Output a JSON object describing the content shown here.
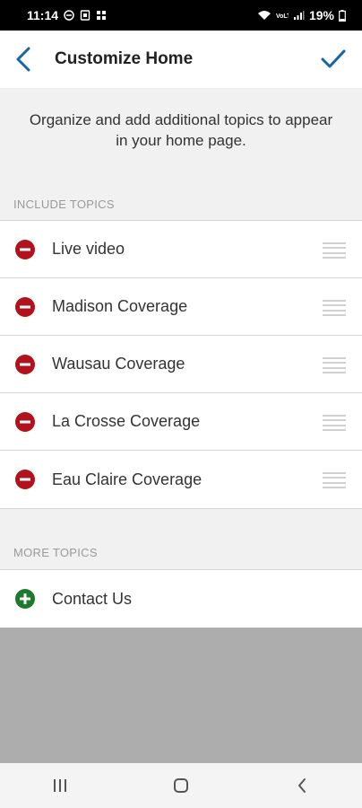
{
  "status_bar": {
    "time": "11:14",
    "battery": "19%",
    "icons": [
      "do-not-disturb-icon",
      "screenshot-icon",
      "grid-app-icon",
      "wifi-icon",
      "volte-icon",
      "signal-icon",
      "battery-icon"
    ]
  },
  "header": {
    "title": "Customize Home",
    "back_icon": "chevron-left-icon",
    "confirm_icon": "checkmark-icon",
    "accent_color": "#1565a8"
  },
  "intro": {
    "text": "Organize and add additional topics to appear in your home page."
  },
  "include_topics": {
    "label": "INCLUDE TOPICS",
    "items": [
      {
        "label": "Live video"
      },
      {
        "label": "Madison Coverage"
      },
      {
        "label": "Wausau Coverage"
      },
      {
        "label": "La Crosse Coverage"
      },
      {
        "label": "Eau Claire Coverage"
      }
    ],
    "remove_color": "#b3121b"
  },
  "more_topics": {
    "label": "MORE TOPICS",
    "items": [
      {
        "label": "Contact Us"
      }
    ],
    "add_color": "#1d7a2c"
  },
  "nav_bar": {
    "buttons": [
      "recent-apps-icon",
      "home-icon",
      "back-icon"
    ]
  }
}
